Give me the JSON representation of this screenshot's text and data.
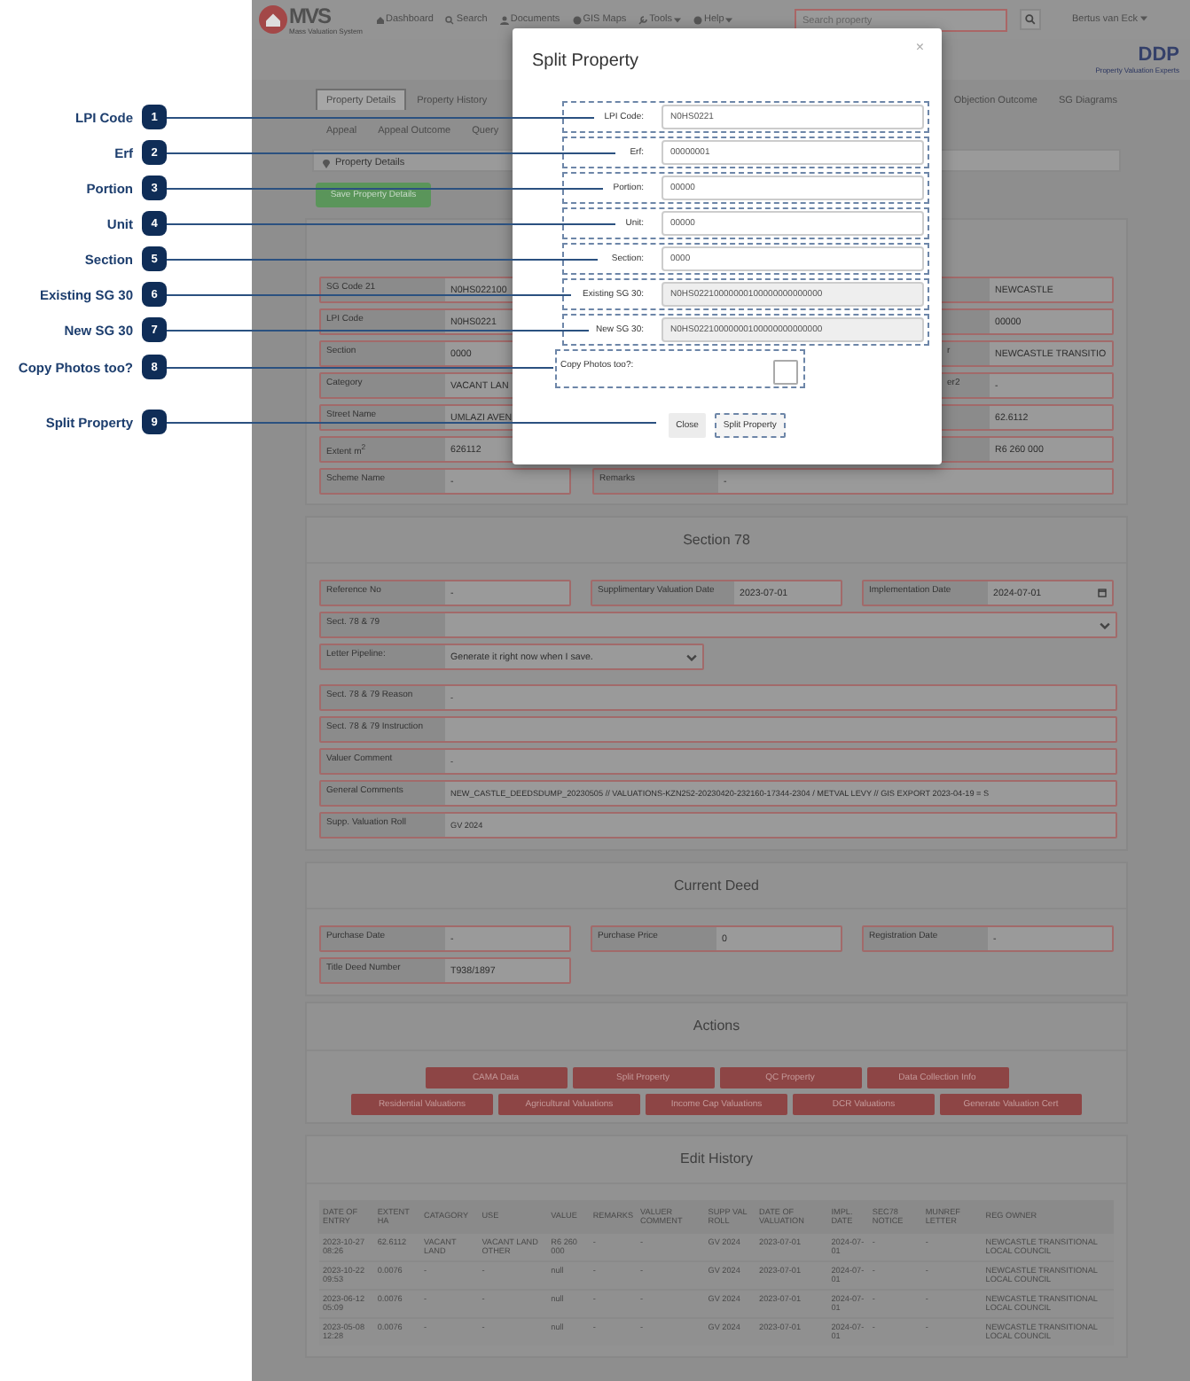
{
  "callouts": [
    {
      "number": "1",
      "label": "LPI Code"
    },
    {
      "number": "2",
      "label": "Erf"
    },
    {
      "number": "3",
      "label": "Portion"
    },
    {
      "number": "4",
      "label": "Unit"
    },
    {
      "number": "5",
      "label": "Section"
    },
    {
      "number": "6",
      "label": "Existing SG 30"
    },
    {
      "number": "7",
      "label": "New SG 30"
    },
    {
      "number": "8",
      "label": "Copy Photos too?"
    },
    {
      "number": "9",
      "label": "Split Property"
    }
  ],
  "nav": {
    "logo": "MVS",
    "logo_subtitle": "Mass Valuation System",
    "items": [
      {
        "label": "Dashboard",
        "dropdown": false
      },
      {
        "label": "Search",
        "dropdown": false
      },
      {
        "label": "Documents",
        "dropdown": false
      },
      {
        "label": "GIS Maps",
        "dropdown": false
      },
      {
        "label": "Tools",
        "dropdown": true
      },
      {
        "label": "Help",
        "dropdown": true
      }
    ],
    "search_placeholder": "Search property",
    "user": "Bertus van Eck"
  },
  "brand": {
    "name": "DDP",
    "tagline": "Property Valuation Experts"
  },
  "tabs_left": [
    {
      "label": "Property Details",
      "selected": true
    },
    {
      "label": "Property History",
      "selected": false
    }
  ],
  "tabs_right": [
    {
      "label": "Objection Outcome",
      "selected": false
    },
    {
      "label": "SG Diagrams",
      "selected": false
    }
  ],
  "tabs_row2": [
    {
      "label": "Appeal",
      "selected": false
    },
    {
      "label": "Appeal Outcome",
      "selected": false
    },
    {
      "label": "Query",
      "selected": false
    }
  ],
  "breadcrumb": "Property Details",
  "save_button": "Save Property Details",
  "details": [
    {
      "label": "SG Code 21",
      "value": "N0HS022100",
      "right_value": "NEWCASTLE"
    },
    {
      "label": "LPI Code",
      "value": "N0HS0221",
      "right_value": "00000"
    },
    {
      "label": "Section",
      "value": "0000",
      "right_label": "r",
      "right_value": "NEWCASTLE TRANSITIO"
    },
    {
      "label": "Category",
      "value": "VACANT LAN",
      "right_label": "er2",
      "right_value": "-"
    },
    {
      "label": "Street Name",
      "value": "UMLAZI AVEN",
      "right_value": "62.6112"
    },
    {
      "label": "Extent m$^{2}$",
      "value": "626112",
      "right_value": "R6 260 000"
    }
  ],
  "details_last": {
    "label": "Scheme Name",
    "value": "-",
    "wide_label": "Remarks",
    "wide_value": "-"
  },
  "section78": {
    "title": "Section 78",
    "top": [
      {
        "label": "Reference No",
        "value": "-",
        "kind": "text"
      },
      {
        "label": "Supplimentary Valuation Date",
        "value": "2023-07-01",
        "kind": "text"
      },
      {
        "label": "Implementation Date",
        "value": "2024-07-01",
        "kind": "date"
      }
    ],
    "select_row": {
      "label": "Sect. 78 & 79"
    },
    "pipeline": {
      "label": "Letter Pipeline:",
      "value": "Generate it right now when I save."
    },
    "rows": [
      {
        "label": "Sect. 78 & 79 Reason",
        "value": "-"
      },
      {
        "label": "Sect. 78 & 79 Instruction"
      },
      {
        "label": "Valuer Comment",
        "value": "-"
      },
      {
        "label": "General Comments",
        "value": "NEW_CASTLE_DEEDSDUMP_20230505 // VALUATIONS-KZN252-20230420-232160-17344-2304 / METVAL LEVY // GIS EXPORT 2023-04-19 = S"
      },
      {
        "label": "Supp. Valuation Roll",
        "value": "GV 2024"
      }
    ]
  },
  "deed": {
    "title": "Current Deed",
    "fields": [
      {
        "label": "Purchase Date",
        "value": "-"
      },
      {
        "label": "Purchase Price",
        "value": "0"
      },
      {
        "label": "Registration Date",
        "value": "-"
      },
      {
        "label": "Title Deed Number",
        "value": "T938/1897"
      }
    ]
  },
  "actions": {
    "title": "Actions",
    "row1": [
      "CAMA Data",
      "Split Property",
      "QC Property",
      "Data Collection Info"
    ],
    "row2": [
      "Residential Valuations",
      "Agricultural Valuations",
      "Income Cap Valuations",
      "DCR Valuations",
      "Generate Valuation Cert"
    ]
  },
  "history": {
    "title": "Edit History",
    "columns": [
      "DATE OF ENTRY",
      "EXTENT HA",
      "CATAGORY",
      "USE",
      "VALUE",
      "REMARKS",
      "VALUER COMMENT",
      "SUPP VAL ROLL",
      "DATE OF VALUATION",
      "IMPL. DATE",
      "SEC78 NOTICE",
      "MUNREF LETTER",
      "REG OWNER"
    ],
    "rows": [
      [
        "2023-10-27 08:26",
        "62.6112",
        "VACANT LAND",
        "VACANT LAND OTHER",
        "R6 260 000",
        "-",
        "-",
        "GV 2024",
        "2023-07-01",
        "2024-07-01",
        "-",
        "-",
        "NEWCASTLE TRANSITIONAL LOCAL COUNCIL"
      ],
      [
        "2023-10-22 09:53",
        "0.0076",
        "-",
        "-",
        "null",
        "-",
        "-",
        "GV 2024",
        "2023-07-01",
        "2024-07-01",
        "-",
        "-",
        "NEWCASTLE TRANSITIONAL LOCAL COUNCIL"
      ],
      [
        "2023-06-12 05:09",
        "0.0076",
        "-",
        "-",
        "null",
        "-",
        "-",
        "GV 2024",
        "2023-07-01",
        "2024-07-01",
        "-",
        "-",
        "NEWCASTLE TRANSITIONAL LOCAL COUNCIL"
      ],
      [
        "2023-05-08 12:28",
        "0.0076",
        "-",
        "-",
        "null",
        "-",
        "-",
        "GV 2024",
        "2023-07-01",
        "2024-07-01",
        "-",
        "-",
        "NEWCASTLE TRANSITIONAL LOCAL COUNCIL"
      ]
    ]
  },
  "modal": {
    "title": "Split Property",
    "close": "×",
    "fields": [
      {
        "label": "LPI Code:",
        "value": "N0HS0221",
        "readonly": false
      },
      {
        "label": "Erf:",
        "value": "00000001",
        "readonly": false
      },
      {
        "label": "Portion:",
        "value": "00000",
        "readonly": false
      },
      {
        "label": "Unit:",
        "value": "00000",
        "readonly": false
      },
      {
        "label": "Section:",
        "value": "0000",
        "readonly": false
      },
      {
        "label": "Existing SG 30:",
        "value": "N0HS02210000000100000000000000",
        "readonly": true
      },
      {
        "label": "New SG 30:",
        "value": "N0HS02210000000100000000000000",
        "readonly": true
      }
    ],
    "copy_photos": {
      "label": "Copy Photos too?:",
      "checked": false
    },
    "buttons": [
      {
        "label": "Close",
        "primary": false
      },
      {
        "label": "Split Property",
        "primary": true
      }
    ]
  }
}
